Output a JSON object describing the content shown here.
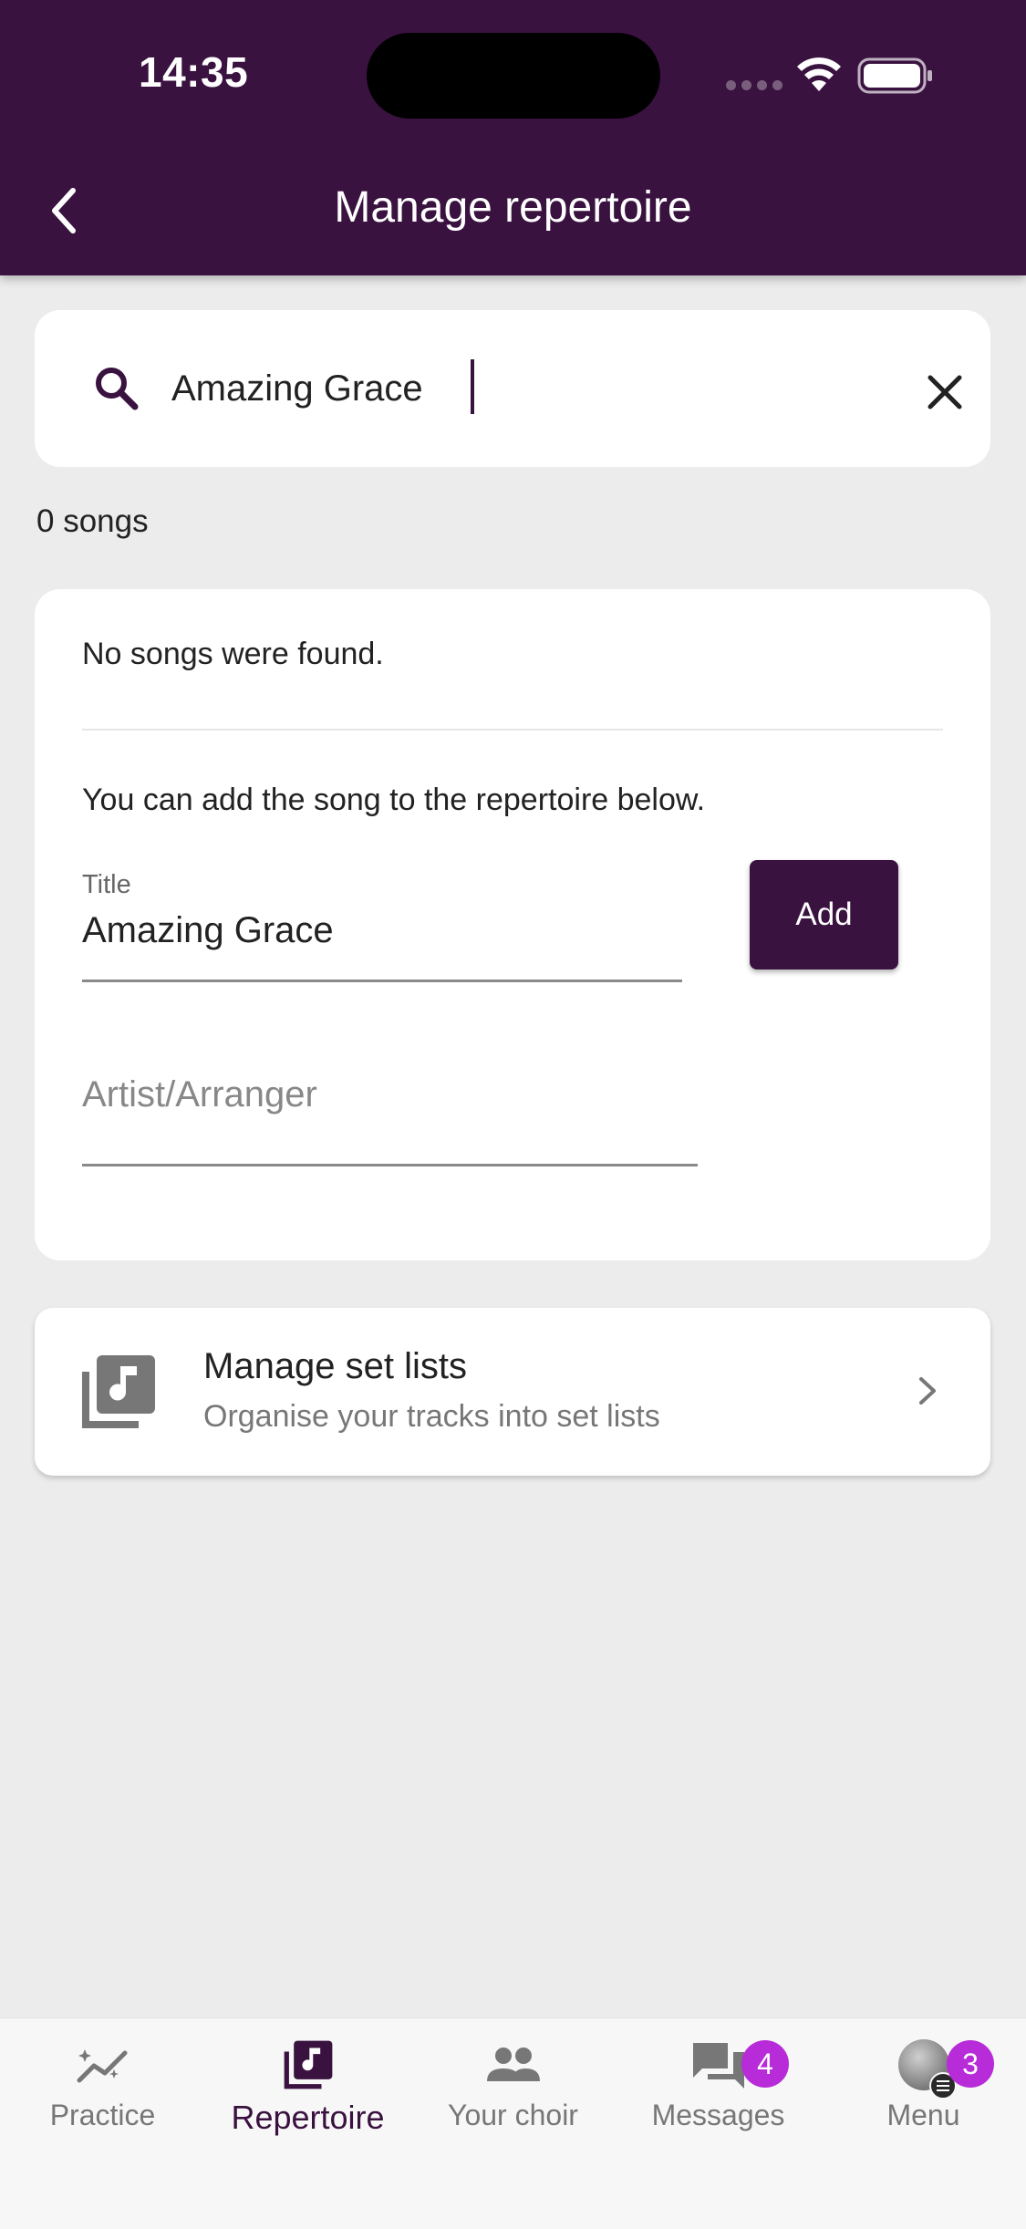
{
  "status_bar": {
    "time": "14:35"
  },
  "header": {
    "title": "Manage repertoire"
  },
  "search": {
    "value": "Amazing Grace"
  },
  "results": {
    "count_label": "0 songs"
  },
  "empty_state": {
    "message": "No songs were found.",
    "hint": "You can add the song to the repertoire below.",
    "title_label": "Title",
    "title_value": "Amazing Grace",
    "add_label": "Add",
    "artist_placeholder": "Artist/Arranger"
  },
  "setlists": {
    "title": "Manage set lists",
    "subtitle": "Organise your tracks into set lists"
  },
  "nav": {
    "items": [
      {
        "label": "Practice",
        "icon": "practice-icon"
      },
      {
        "label": "Repertoire",
        "icon": "repertoire-icon",
        "active": true
      },
      {
        "label": "Your choir",
        "icon": "choir-icon"
      },
      {
        "label": "Messages",
        "icon": "messages-icon",
        "badge": "4"
      },
      {
        "label": "Menu",
        "icon": "avatar",
        "badge": "3"
      }
    ]
  },
  "colors": {
    "brand": "#3a1240",
    "badge": "#b72bd8"
  }
}
